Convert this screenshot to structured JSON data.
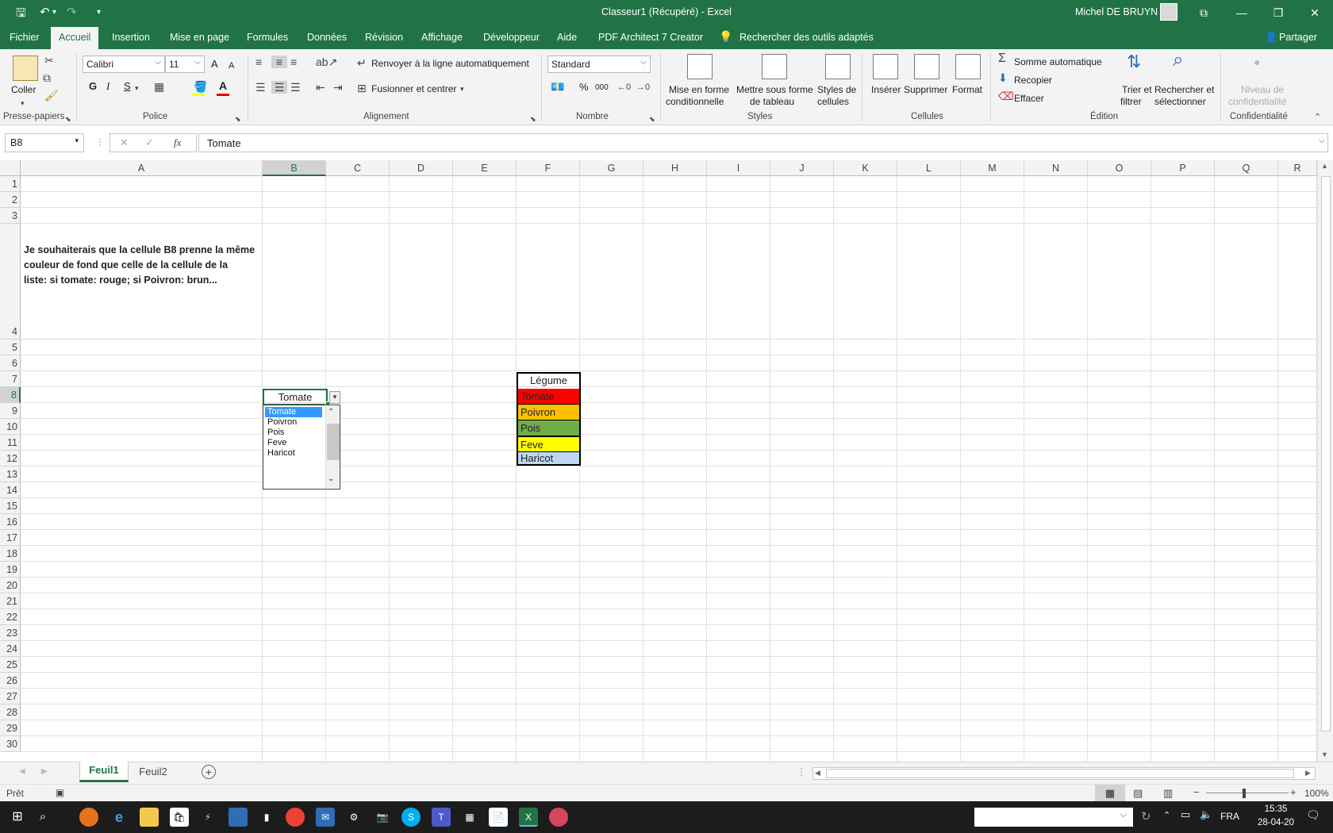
{
  "window": {
    "title": "Classeur1 (Récupéré)  -  Excel",
    "user": "Michel DE BRUYN"
  },
  "tabs": [
    "Fichier",
    "Accueil",
    "Insertion",
    "Mise en page",
    "Formules",
    "Données",
    "Révision",
    "Affichage",
    "Développeur",
    "Aide",
    "PDF Architect 7 Creator"
  ],
  "active_tab": "Accueil",
  "tell_me": "Rechercher des outils adaptés",
  "share": "Partager",
  "ribbon": {
    "clipboard": {
      "paste": "Coller",
      "group": "Presse-papiers"
    },
    "font": {
      "name": "Calibri",
      "size": "11",
      "bold": "G",
      "italic": "I",
      "underline": "S",
      "grow": "A",
      "shrink": "A",
      "group": "Police"
    },
    "alignment": {
      "wrap": "Renvoyer à la ligne automatiquement",
      "merge": "Fusionner et centrer",
      "group": "Alignement"
    },
    "number": {
      "format": "Standard",
      "percent": "%",
      "thousands": "000",
      "group": "Nombre"
    },
    "styles": {
      "conditional_1": "Mise en forme",
      "conditional_2": "conditionnelle",
      "table_1": "Mettre sous forme",
      "table_2": "de tableau",
      "cell_1": "Styles de",
      "cell_2": "cellules",
      "group": "Styles"
    },
    "cells": {
      "insert": "Insérer",
      "delete": "Supprimer",
      "format": "Format",
      "group": "Cellules"
    },
    "editing": {
      "autosum": "Somme automatique",
      "fill": "Recopier",
      "clear": "Effacer",
      "sort_1": "Trier et",
      "sort_2": "filtrer",
      "find_1": "Rechercher et",
      "find_2": "sélectionner",
      "group": "Édition"
    },
    "sensitivity": {
      "label_1": "Niveau de",
      "label_2": "confidentialité",
      "group": "Confidentialité"
    }
  },
  "formula_bar": {
    "name_box": "B8",
    "fx": "fx",
    "value": "Tomate"
  },
  "columns": [
    "A",
    "B",
    "C",
    "D",
    "E",
    "F",
    "G",
    "H",
    "I",
    "J",
    "K",
    "L",
    "M",
    "N",
    "O",
    "P",
    "Q",
    "R"
  ],
  "rows": [
    "1",
    "2",
    "3",
    "4",
    "5",
    "6",
    "7",
    "8",
    "9",
    "10",
    "11",
    "12",
    "13",
    "14",
    "15",
    "16",
    "17",
    "18",
    "19",
    "20",
    "21",
    "22",
    "23",
    "24",
    "25",
    "26",
    "27",
    "28",
    "29",
    "30"
  ],
  "cells": {
    "A4_line1": "Je souhaiterais que la cellule B8 prenne la même",
    "A4_line2": "couleur de fond que celle de la cellule de la",
    "A4_line3": "liste: si tomate: rouge; si Poivron: brun...",
    "B8": "Tomate",
    "F7": "Légume",
    "F8": "Tomate",
    "F9": "Poivron",
    "F10": "Pois",
    "F11": "Feve",
    "F12": "Haricot"
  },
  "list_colors": {
    "Tomate": "#ff0000",
    "Poivron": "#ffc000",
    "Pois": "#70ad47",
    "Feve": "#ffff00",
    "Haricot": "#bdd7ee"
  },
  "dropdown": {
    "items": [
      "Tomate",
      "Poivron",
      "Pois",
      "Feve",
      "Haricot"
    ],
    "selected": "Tomate"
  },
  "sheets": [
    "Feuil1",
    "Feuil2"
  ],
  "active_sheet": "Feuil1",
  "status": {
    "ready": "Prêt",
    "zoom": "100%"
  },
  "taskbar": {
    "lang": "FRA",
    "time": "15:35",
    "date": "28-04-20"
  }
}
